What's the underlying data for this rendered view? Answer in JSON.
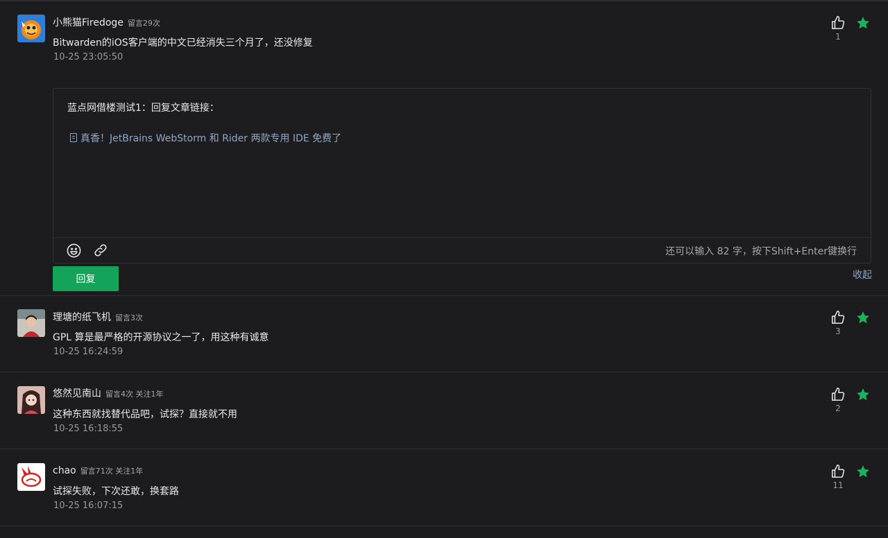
{
  "colors": {
    "background": "#1c1c1f",
    "accent_green": "#13a459",
    "star_green": "#1db35c",
    "link_blue": "#8fa6c8",
    "muted": "#9a9a9a"
  },
  "icons": {
    "like": "thumbs-up-icon",
    "favorite": "star-icon",
    "emoji": "smiley-icon",
    "link": "link-icon",
    "article": "document-icon"
  },
  "comments": [
    {
      "name": "小熊猫Firedoge",
      "meta": "留言29次",
      "text": "Bitwarden的iOS客户端的中文已经消失三个月了，还没修复",
      "time": "10-25 23:05:50",
      "likes": "1"
    },
    {
      "name": "理塘的纸飞机",
      "meta": "留言3次",
      "text": "GPL 算是最严格的开源协议之一了，用这种有诚意",
      "time": "10-25 16:24:59",
      "likes": "3"
    },
    {
      "name": "悠然见南山",
      "meta": "留言4次 关注1年",
      "text": "这种东西就找替代品吧，试探？直接就不用",
      "time": "10-25 16:18:55",
      "likes": "2"
    },
    {
      "name": "chao",
      "meta": "留言71次 关注1年",
      "text": "试探失败，下次还敢，换套路",
      "time": "10-25 16:07:15",
      "likes": "11"
    }
  ],
  "reply_editor": {
    "prefix": "蓝点网借楼测试1：回复文章链接：",
    "link_text": "真香！JetBrains WebStorm 和 Rider 两款专用 IDE 免费了",
    "counter": "还可以输入 82 字，按下Shift+Enter键换行",
    "submit_label": "回复",
    "collapse_label": "收起"
  }
}
